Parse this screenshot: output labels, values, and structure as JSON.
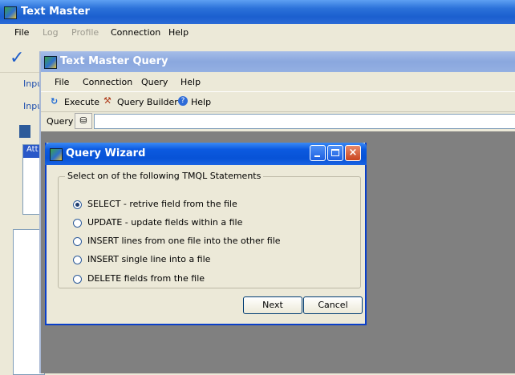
{
  "main_window": {
    "title": "Text Master",
    "menu": [
      {
        "label": "File",
        "enabled": true
      },
      {
        "label": "Log",
        "enabled": false
      },
      {
        "label": "Profile",
        "enabled": false
      },
      {
        "label": "Connection",
        "enabled": true
      },
      {
        "label": "Help",
        "enabled": true
      }
    ],
    "side_labels": [
      "Inpu",
      "Inpu"
    ],
    "tab_header": "Att"
  },
  "query_window": {
    "title": "Text Master Query",
    "menu": [
      "File",
      "Connection",
      "Query",
      "Help"
    ],
    "toolbar": {
      "execute": "Execute",
      "query_builder": "Query Builder",
      "help": "Help"
    },
    "query_label": "Query",
    "query_value": ""
  },
  "wizard": {
    "title": "Query Wizard",
    "group_label": "Select on of the following TMQL Statements",
    "options": [
      "SELECT - retrive field from the file",
      "UPDATE  - update fields within a file",
      "INSERT lines from one file into the other file",
      "INSERT single line into a file",
      "DELETE fields from the file"
    ],
    "selected_index": 0,
    "next_label": "Next",
    "cancel_label": "Cancel"
  },
  "colors": {
    "titlebar_active": "#0752d6",
    "titlebar_inactive": "#8aa7de",
    "workspace": "#808080"
  }
}
